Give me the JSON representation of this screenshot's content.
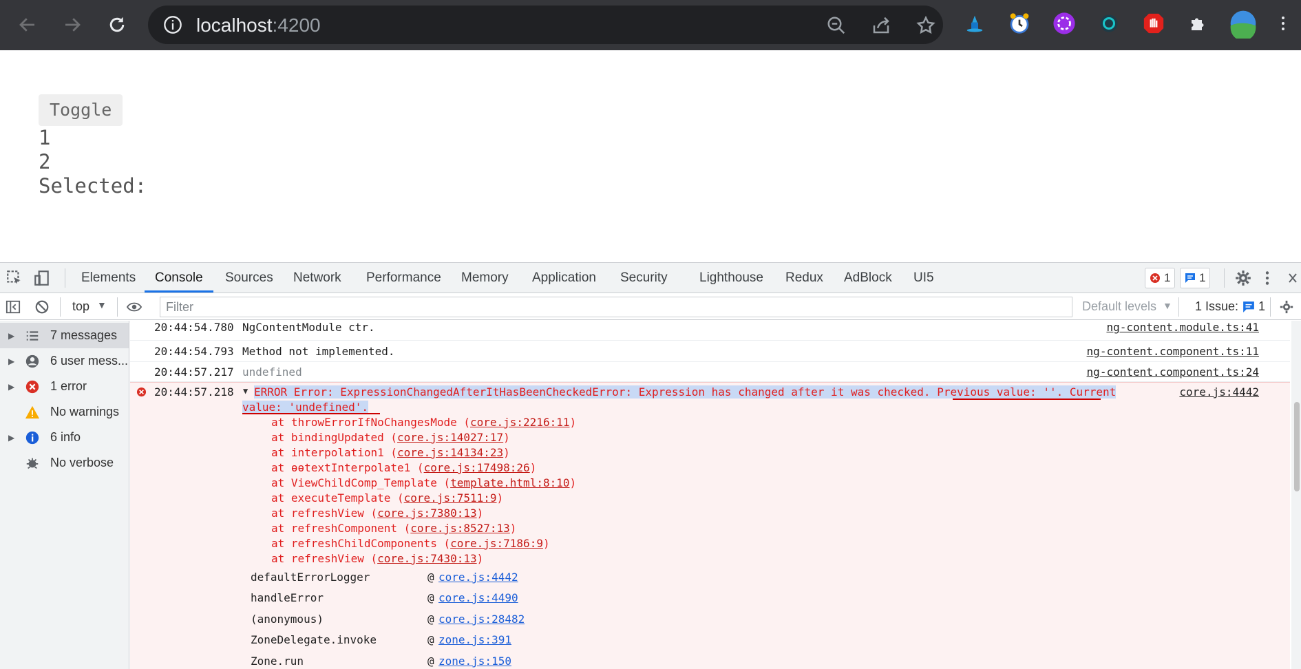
{
  "browser": {
    "url_host": "localhost",
    "url_port": ":4200"
  },
  "page": {
    "toggle_label": "Toggle",
    "line1": "1",
    "line2": "2",
    "selected_label": "Selected:"
  },
  "devtools": {
    "tabs": [
      "Elements",
      "Console",
      "Sources",
      "Network",
      "Performance",
      "Memory",
      "Application",
      "Security",
      "Lighthouse",
      "Redux",
      "AdBlock",
      "UI5"
    ],
    "active_tab": "Console",
    "error_count": "1",
    "message_count": "1",
    "context": "top",
    "filter_placeholder": "Filter",
    "default_levels": "Default levels",
    "issues_label": "1 Issue:",
    "issues_count": "1",
    "sidebar": [
      {
        "label": "7 messages",
        "icon": "list-icon"
      },
      {
        "label": "6 user mess...",
        "icon": "user-icon"
      },
      {
        "label": "1 error",
        "icon": "error-icon"
      },
      {
        "label": "No warnings",
        "icon": "warning-icon"
      },
      {
        "label": "6 info",
        "icon": "info-icon"
      },
      {
        "label": "No verbose",
        "icon": "verbose-icon"
      }
    ]
  },
  "console": {
    "messages": [
      {
        "time": "20:44:54.780",
        "text": "NgContentModule ctr.",
        "source": "ng-content.module.ts:41"
      },
      {
        "time": "20:44:54.793",
        "text": "Method not implemented.",
        "source": "ng-content.component.ts:11"
      },
      {
        "time": "20:44:57.217",
        "text": "undefined",
        "source": "ng-content.component.ts:24"
      }
    ],
    "error": {
      "time": "20:44:57.218",
      "line1_pre": "ERROR Error: ExpressionChangedAfterItHasBeenCheckedError: Expression has changed after it was checked",
      "line1_post": ". Previous value: ''. Current",
      "line2": "value: 'undefined'.",
      "source": "core.js:4442",
      "stack": [
        {
          "fn": "at throwErrorIfNoChangesMode (",
          "link": "core.js:2216:11",
          "end": ")"
        },
        {
          "fn": "at bindingUpdated (",
          "link": "core.js:14027:17",
          "end": ")"
        },
        {
          "fn": "at interpolation1 (",
          "link": "core.js:14134:23",
          "end": ")"
        },
        {
          "fn": "at ɵɵtextInterpolate1 (",
          "link": "core.js:17498:26",
          "end": ")"
        },
        {
          "fn": "at ViewChildComp_Template (",
          "link": "template.html:8:10",
          "end": ")"
        },
        {
          "fn": "at executeTemplate (",
          "link": "core.js:7511:9",
          "end": ")"
        },
        {
          "fn": "at refreshView (",
          "link": "core.js:7380:13",
          "end": ")"
        },
        {
          "fn": "at refreshComponent (",
          "link": "core.js:8527:13",
          "end": ")"
        },
        {
          "fn": "at refreshChildComponents (",
          "link": "core.js:7186:9",
          "end": ")"
        },
        {
          "fn": "at refreshView (",
          "link": "core.js:7430:13",
          "end": ")"
        }
      ],
      "async": [
        {
          "fn": "defaultErrorLogger",
          "link": "core.js:4442"
        },
        {
          "fn": "handleError",
          "link": "core.js:4490"
        },
        {
          "fn": "(anonymous)",
          "link": "core.js:28482"
        },
        {
          "fn": "ZoneDelegate.invoke",
          "link": "zone.js:391"
        },
        {
          "fn": "Zone.run",
          "link": "zone.js:150"
        }
      ]
    }
  }
}
